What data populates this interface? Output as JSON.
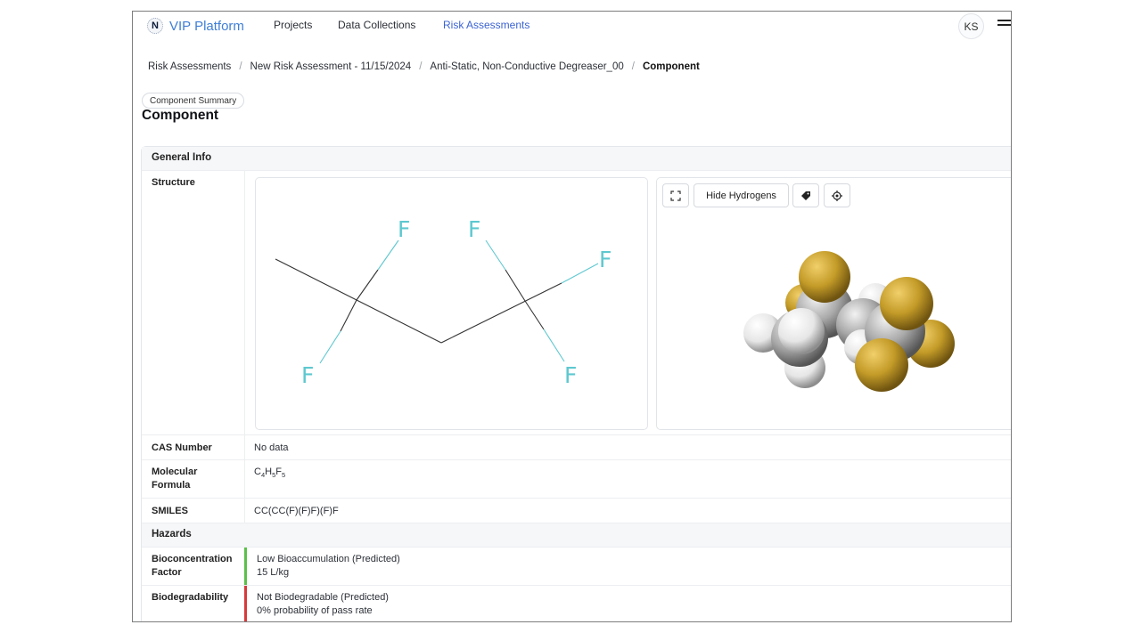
{
  "nav": {
    "logo_letter": "N",
    "logo_text": "VIP Platform",
    "links": [
      "Projects",
      "Data Collections",
      "Risk Assessments"
    ],
    "active_index": 2,
    "user_initials": "KS"
  },
  "breadcrumb": {
    "items": [
      "Risk Assessments",
      "New Risk Assessment - 11/15/2024",
      "Anti-Static, Non-Conductive Degreaser_00"
    ],
    "current": "Component",
    "separator": "/"
  },
  "header": {
    "pill": "Component Summary",
    "title": "Component"
  },
  "general_info": {
    "section_title": "General Info",
    "structure_label": "Structure",
    "viewer": {
      "hide_hydrogens_label": "Hide Hydrogens",
      "icons": [
        "expand-icon",
        "tag-icon",
        "target-icon"
      ]
    },
    "atom_label": "F",
    "cas_label": "CAS Number",
    "cas_value": "No data",
    "formula_label": "Molecular Formula",
    "formula_parts": [
      "C",
      "4",
      "H",
      "5",
      "F",
      "5"
    ],
    "smiles_label": "SMILES",
    "smiles_value": "CC(CC(F)(F)F)(F)F"
  },
  "hazards": {
    "section_title": "Hazards",
    "items": [
      {
        "label": "Bioconcentration Factor",
        "line1": "Low Bioaccumulation (Predicted)",
        "line2": "15 L/kg",
        "color": "#5cc04a"
      },
      {
        "label": "Biodegradability",
        "line1": "Not Biodegradable (Predicted)",
        "line2": "0% probability of pass rate",
        "color": "#d8393a"
      }
    ]
  },
  "colors": {
    "accent": "#3b63d1",
    "fluorine_2d": "#5ec8d0",
    "fluorine_3d": "#c39b28",
    "carbon_3d": "#a9a9a9",
    "hydrogen_3d": "#efefef"
  }
}
